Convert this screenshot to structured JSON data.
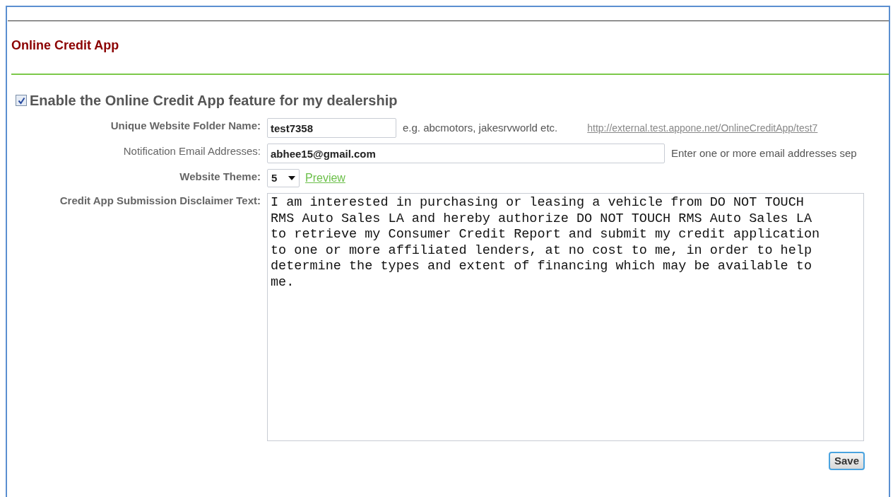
{
  "title": "Online Credit App",
  "enable": {
    "label": "Enable the Online Credit App feature for my dealership",
    "checked": true
  },
  "fields": [
    {
      "kind": "text",
      "label": "Unique Website Folder Name:",
      "label_bold": true,
      "value": "test7358",
      "hint": "e.g. abcmotors, jakesrvworld etc.",
      "link": "http://external.test.appone.net/OnlineCreditApp/test7"
    },
    {
      "kind": "text",
      "label": "Notification Email Addresses:",
      "label_bold": false,
      "value": "abhee15@gmail.com",
      "hint": "Enter one or more email addresses sep"
    },
    {
      "kind": "select",
      "label": "Website Theme:",
      "label_bold": true,
      "value": "5",
      "link": "Preview"
    },
    {
      "kind": "textarea",
      "label": "Credit App Submission Disclaimer Text:",
      "label_bold": true,
      "value": "I am interested in purchasing or leasing a vehicle from DO NOT TOUCH RMS Auto Sales LA and hereby authorize DO NOT TOUCH RMS Auto Sales LA to retrieve my Consumer Credit Report and submit my credit application to one or more affiliated lenders, at no cost to me, in order to help determine the types and extent of financing which may be available to me."
    }
  ],
  "save": "Save"
}
